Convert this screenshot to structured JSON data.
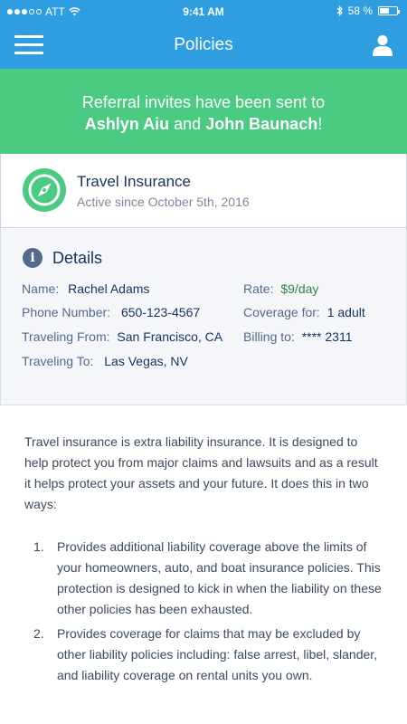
{
  "status_bar": {
    "carrier": "ATT",
    "time": "9:41 AM",
    "battery": "58 %",
    "battery_level": 0.58
  },
  "nav": {
    "title": "Policies"
  },
  "banner": {
    "line1": "Referral invites have been sent to",
    "name1": "Ashlyn Aiu",
    "connector": "and",
    "name2": "John Baunach",
    "punct": "!"
  },
  "policy": {
    "title": "Travel Insurance",
    "subtitle": "Active since October 5th, 2016"
  },
  "details": {
    "title": "Details",
    "left": [
      {
        "label": "Name:",
        "value": "Rachel Adams"
      },
      {
        "label": "Phone Number:",
        "value": "650-123-4567"
      },
      {
        "label": "Traveling From:",
        "value": "San Francisco, CA"
      },
      {
        "label": "Traveling To:",
        "value": "Las Vegas, NV"
      }
    ],
    "right": [
      {
        "label": "Rate:",
        "value": "$9/day"
      },
      {
        "label": "Coverage for:",
        "value": "1 adult"
      },
      {
        "label": "Billing to:",
        "value": "**** 2311"
      }
    ]
  },
  "body": {
    "intro": "Travel insurance is extra liability insurance. It is designed to help protect you from major claims and lawsuits and as a result it helps protect your assets and your future. It does this in two ways:",
    "items": [
      {
        "num": "1.",
        "text": "Provides additional liability coverage above the limits of your homeowners, auto, and boat insurance policies. This protection is designed to kick in when the liability on these other policies has been exhausted."
      },
      {
        "num": "2.",
        "text": "Provides coverage for claims that may be excluded by other liability policies including: false arrest, libel, slander, and liability coverage on rental units you own."
      }
    ]
  }
}
